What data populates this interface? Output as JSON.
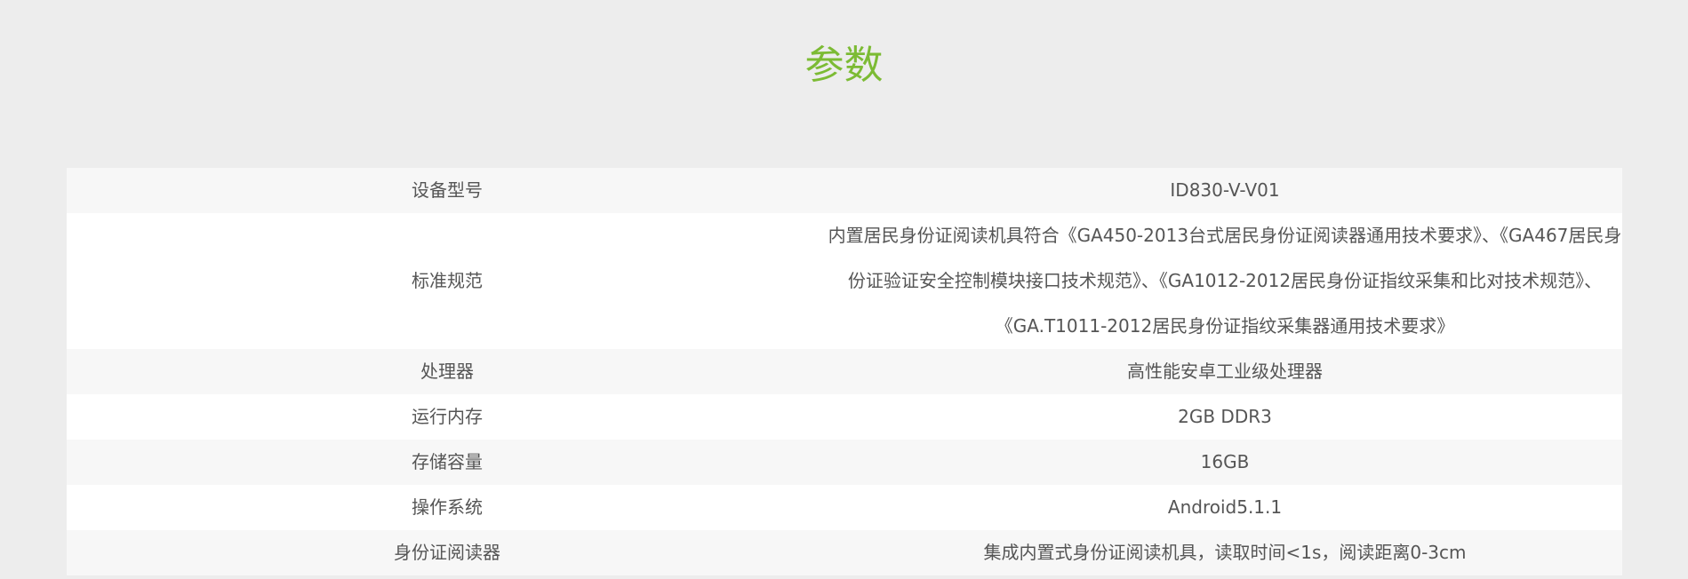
{
  "header": {
    "title": "参数"
  },
  "specs": [
    {
      "label": "设备型号",
      "value": "ID830-V-V01"
    },
    {
      "label": "标准规范",
      "value": "内置居民身份证阅读机具符合《GA450-2013台式居民身份证阅读器通用技术要求》、《GA467居民身份证验证安全控制模块接口技术规范》、《GA1012-2012居民身份证指纹采集和比对技术规范》、《GA.T1011-2012居民身份证指纹采集器通用技术要求》"
    },
    {
      "label": "处理器",
      "value": "高性能安卓工业级处理器"
    },
    {
      "label": "运行内存",
      "value": "2GB DDR3"
    },
    {
      "label": "存储容量",
      "value": "16GB"
    },
    {
      "label": "操作系统",
      "value": "Android5.1.1"
    },
    {
      "label": "身份证阅读器",
      "value": "集成内置式身份证阅读机具，读取时间<1s，阅读距离0-3cm"
    }
  ],
  "colors": {
    "title": "#7cbb34",
    "page_background": "#ededed",
    "row_shaded": "#f7f7f7",
    "row_plain": "#ffffff",
    "text": "#555555"
  }
}
